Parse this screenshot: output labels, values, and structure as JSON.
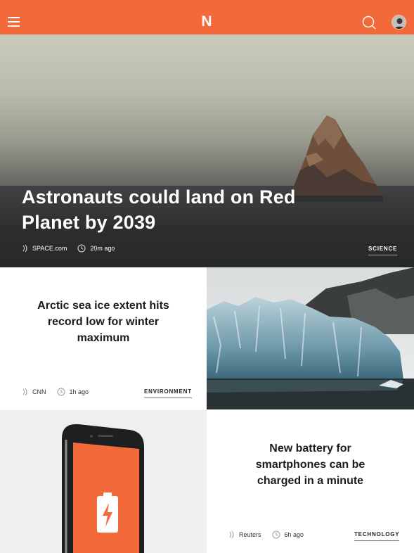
{
  "header": {
    "logo_letter": "N",
    "brand_color": "#f26a3a",
    "icons": [
      "menu-icon",
      "search-icon",
      "avatar"
    ]
  },
  "hero": {
    "title": "Astronauts could land on Red Planet by 2039",
    "source": "SPACE.com",
    "time": "20m ago",
    "category": "SCIENCE"
  },
  "articles": [
    {
      "title": "Arctic sea ice extent hits record low for winter maximum",
      "source": "CNN",
      "time": "1h ago",
      "category": "ENVIRONMENT"
    },
    {
      "title": "New battery for smartphones can be charged in a minute",
      "source": "Reuters",
      "time": "6h ago",
      "category": "TECHNOLOGY"
    }
  ]
}
